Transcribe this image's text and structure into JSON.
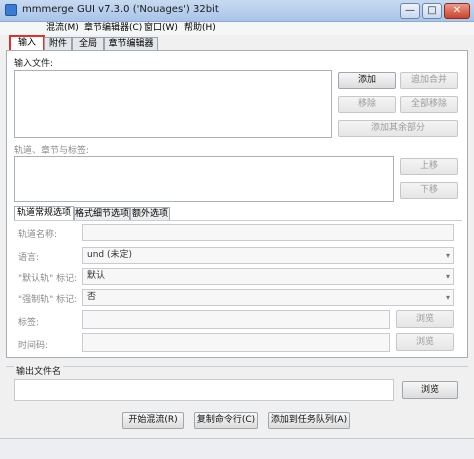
{
  "window": {
    "title": "mmmerge GUI v7.3.0 ('Nouages') 32bit",
    "controls": {
      "minimize": "—",
      "maximize": "□",
      "close": "✕"
    }
  },
  "menu": [
    "混流(M)",
    "章节编辑器(C)",
    "窗口(W)",
    "帮助(H)"
  ],
  "tabs": [
    "输入",
    "附件",
    "全局",
    "章节编辑器"
  ],
  "input": {
    "files_label": "输入文件:",
    "add": "添加",
    "append": "追加合并",
    "remove": "移除",
    "remove_all": "全部移除",
    "add_other_parts": "添加其余部分",
    "tracks_label": "轨道、章节与标签:",
    "move_up": "上移",
    "move_down": "下移"
  },
  "subtabs": [
    "轨道常规选项",
    "格式细节选项",
    "额外选项"
  ],
  "options": {
    "track_name_label": "轨道名称:",
    "language_label": "语言:",
    "language_value": "und (未定)",
    "default_flag_label": "\"默认轨\" 标记:",
    "default_flag_value": "默认",
    "forced_flag_label": "\"强制轨\" 标记:",
    "forced_flag_value": "否",
    "tags_label": "标签:",
    "timecodes_label": "时间码:",
    "browse": "浏览"
  },
  "output": {
    "label": "输出文件名",
    "browse": "浏览"
  },
  "actions": {
    "start": "开始混流(R)",
    "copy_cmd": "复制命令行(C)",
    "add_job": "添加到任务队列(A)"
  },
  "colors": {
    "highlight": "#e0322b",
    "title_bar": "#b8d0ee"
  }
}
